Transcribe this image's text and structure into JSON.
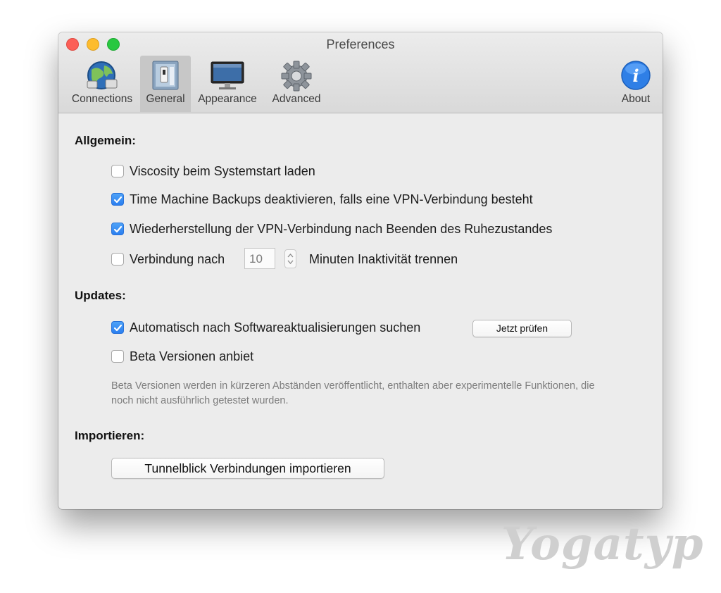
{
  "window": {
    "title": "Preferences"
  },
  "toolbar": {
    "items": [
      {
        "label": "Connections",
        "icon": "globe-network-icon"
      },
      {
        "label": "General",
        "icon": "light-switch-icon",
        "selected": true
      },
      {
        "label": "Appearance",
        "icon": "monitor-icon"
      },
      {
        "label": "Advanced",
        "icon": "gear-icon"
      },
      {
        "label": "About",
        "icon": "info-icon"
      }
    ]
  },
  "sections": {
    "general": {
      "heading": "Allgemein:",
      "options": [
        {
          "label": "Viscosity beim Systemstart laden",
          "checked": false
        },
        {
          "label": "Time Machine Backups deaktivieren, falls eine VPN-Verbindung besteht",
          "checked": true
        },
        {
          "label": "Wiederherstellung der VPN-Verbindung nach Beenden des Ruhezustandes",
          "checked": true
        },
        {
          "label": "Verbindung nach",
          "checked": false
        }
      ],
      "timeout_value": "10",
      "timeout_suffix": "Minuten Inaktivität trennen"
    },
    "updates": {
      "heading": "Updates:",
      "auto_check_label": "Automatisch nach Softwareaktualisierungen suchen",
      "auto_check_checked": true,
      "check_now_button": "Jetzt prüfen",
      "beta_label": "Beta Versionen anbiet",
      "beta_checked": false,
      "beta_help": "Beta Versionen werden in kürzeren Abständen veröffentlicht, enthalten aber experimentelle Funktionen, die noch nicht ausführlich getestet wurden."
    },
    "import": {
      "heading": "Importieren:",
      "button": "Tunnelblick Verbindungen importieren"
    }
  },
  "watermark": "Yogatyp",
  "colors": {
    "accent": "#2b7ff0",
    "close": "#fc5f57",
    "minimize": "#fdbc2e",
    "maximize": "#28c840"
  }
}
